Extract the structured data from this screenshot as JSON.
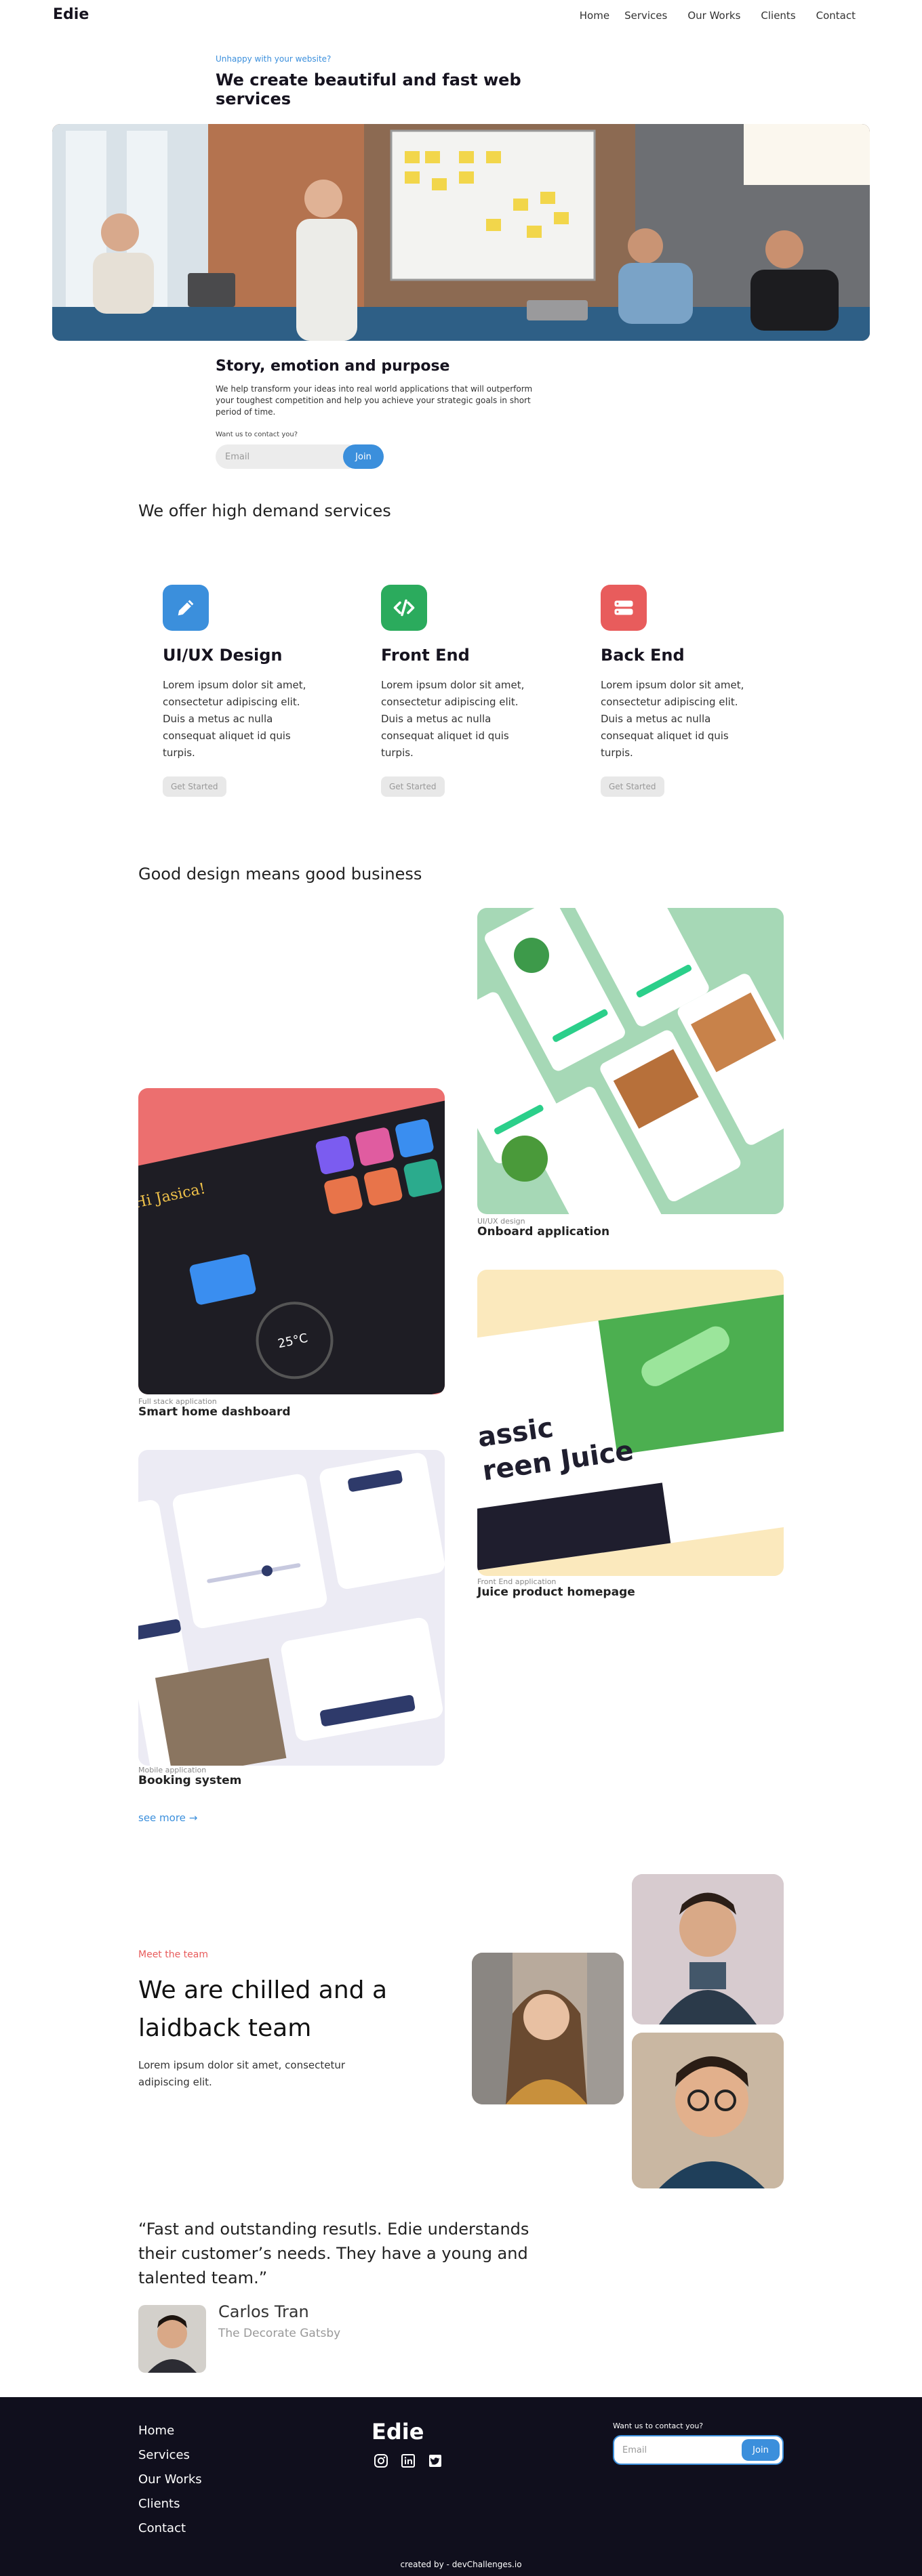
{
  "nav": {
    "logo": "Edie",
    "links": [
      "Home",
      "Services",
      "Our Works",
      "Clients",
      "Contact"
    ]
  },
  "hero": {
    "eyebrow": "Unhappy with your website?",
    "title": "We create beautiful and fast web services",
    "story_title": "Story, emotion and purpose",
    "story_text": "We help transform your ideas into real world applications that will outperform your toughest competition and help you achieve your strategic goals in short period of time.",
    "want_label": "Want us to contact you?",
    "email_placeholder": "Email",
    "join_label": "Join"
  },
  "services": {
    "title": "We offer high demand services",
    "items": [
      {
        "name": "UI/UX Design",
        "text": "Lorem ipsum dolor sit amet, consectetur adipiscing elit. Duis a metus ac nulla consequat aliquet id quis turpis.",
        "button": "Get Started",
        "icon": "pencil-icon",
        "color": "#3b8fdc"
      },
      {
        "name": "Front End",
        "text": "Lorem ipsum dolor sit amet, consectetur adipiscing elit. Duis a metus ac nulla consequat aliquet id quis turpis.",
        "button": "Get Started",
        "icon": "code-icon",
        "color": "#2bab5d"
      },
      {
        "name": "Back End",
        "text": "Lorem ipsum dolor sit amet, consectetur adipiscing elit. Duis a metus ac nulla consequat aliquet id quis turpis.",
        "button": "Get Started",
        "icon": "server-icon",
        "color": "#e85c5c"
      }
    ]
  },
  "portfolio": {
    "title": "Good design means good business",
    "items": [
      {
        "tag": "UI/UX design",
        "name": "Onboard application"
      },
      {
        "tag": "Full stack application",
        "name": "Smart home dashboard"
      },
      {
        "tag": "Front End application",
        "name": "Juice product homepage"
      },
      {
        "tag": "Mobile application",
        "name": "Booking system"
      }
    ],
    "see_more": "see more",
    "juice_text": "assic reen Juice"
  },
  "team": {
    "eyebrow": "Meet the team",
    "title": "We are chilled and a laidback team",
    "text": "Lorem ipsum dolor sit amet, consectetur adipiscing elit."
  },
  "testimonial": {
    "quote": "“Fast and outstanding resutls. Edie understands their customer’s needs. They have a young and talented team.”",
    "name": "Carlos Tran",
    "role": "The Decorate Gatsby"
  },
  "footer": {
    "links": [
      "Home",
      "Services",
      "Our Works",
      "Clients",
      "Contact"
    ],
    "logo": "Edie",
    "social": [
      "instagram-icon",
      "linkedin-icon",
      "twitter-icon"
    ],
    "want_label": "Want us to contact you?",
    "email_placeholder": "Email",
    "join_label": "Join",
    "credit_prefix": "created by",
    "credit_author": "",
    "credit_suffix": "- devChallenges.io"
  },
  "colors": {
    "accent": "#3b8fdc",
    "green": "#2bab5d",
    "red": "#e85c5c",
    "footer_bg": "#100f1d"
  }
}
